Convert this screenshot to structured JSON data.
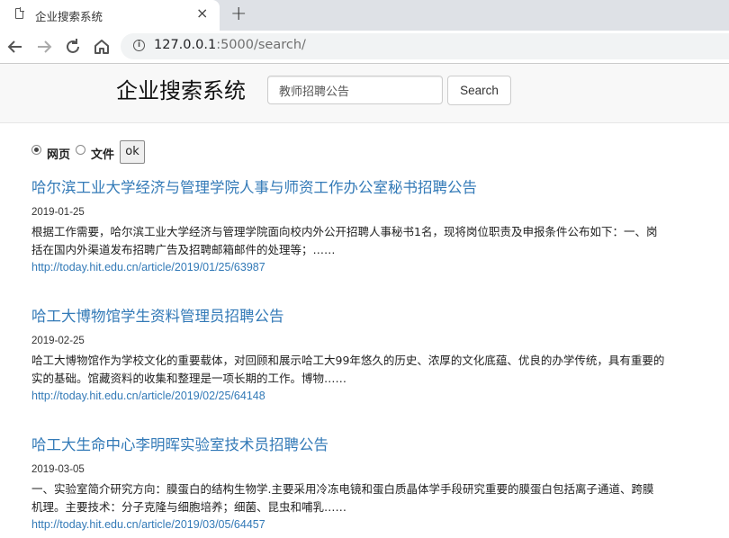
{
  "browser": {
    "tab_title": "企业搜索系统",
    "tab_close": "×",
    "new_tab": "+",
    "url_host": "127.0.0.1",
    "url_rest": ":5000/search/"
  },
  "header": {
    "title": "企业搜索系统",
    "search_value": "教师招聘公告",
    "search_button": "Search"
  },
  "filter": {
    "options": [
      {
        "label": "网页",
        "checked": true
      },
      {
        "label": "文件",
        "checked": false
      }
    ],
    "ok_label": "ok"
  },
  "results": [
    {
      "title": "哈尔滨工业大学经济与管理学院人事与师资工作办公室秘书招聘公告",
      "date": "2019-01-25",
      "line1": "根据工作需要，哈尔滨工业大学经济与管理学院面向校内外公开招聘人事秘书1名，现将岗位职责及申报条件公布如下：一、岗",
      "line2": "括在国内外渠道发布招聘广告及招聘邮箱邮件的处理等；……",
      "url": "http://today.hit.edu.cn/article/2019/01/25/63987"
    },
    {
      "title": "哈工大博物馆学生资料管理员招聘公告",
      "date": "2019-02-25",
      "line1": "哈工大博物馆作为学校文化的重要载体，对回顾和展示哈工大99年悠久的历史、浓厚的文化底蕴、优良的办学传统，具有重要的",
      "line2": "实的基础。馆藏资料的收集和整理是一项长期的工作。博物……",
      "url": "http://today.hit.edu.cn/article/2019/02/25/64148"
    },
    {
      "title": "哈工大生命中心李明晖实验室技术员招聘公告",
      "date": "2019-03-05",
      "line1": "一、实验室简介研究方向：膜蛋白的结构生物学.主要采用冷冻电镜和蛋白质晶体学手段研究重要的膜蛋白包括离子通道、跨膜",
      "line2": "机理。主要技术：分子克隆与细胞培养；细菌、昆虫和哺乳……",
      "url": "http://today.hit.edu.cn/article/2019/03/05/64457"
    }
  ]
}
